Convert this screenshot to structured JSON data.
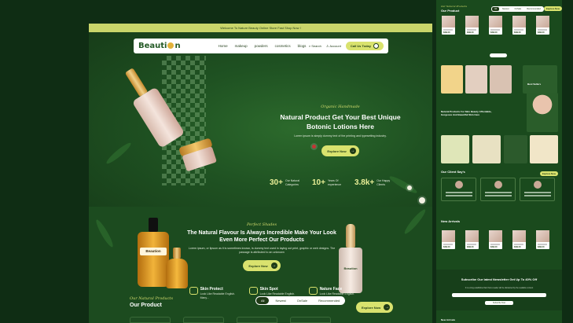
{
  "announcement": "Welcome To Nature Beauty Online Store Fast Shop Now !",
  "brand": {
    "logo": "Beaution"
  },
  "nav": {
    "links": [
      "Home",
      "makeup",
      "powders",
      "cosmetics",
      "blogs"
    ],
    "search": "Search",
    "account": "Account",
    "call_label": "Call Us Today"
  },
  "hero": {
    "script": "Organic Handmade",
    "title": "Natural Product Get Your Best Unique Botonic Lotions Here",
    "description": "Lorem ipsum is simply dummy text of the printing and typesetting industry.",
    "cta": "Explore Now",
    "stats": [
      {
        "value": "30+",
        "label": "Our Natural Categories"
      },
      {
        "value": "10+",
        "label": "Years Of experience"
      },
      {
        "value": "3.8k+",
        "label": "Our Happy Clients"
      }
    ]
  },
  "about": {
    "script": "Perfect Shades",
    "title": "The Natural Flavour Is Always Incredible Make Your Look Even More Perfect Our Products",
    "description": "Lorem ipsum, or lipsum as it is sometimes known, is dummy text used in laying out print, graphic or web designs. The passage is attributed to an unknown",
    "cta": "Explore Now",
    "bottle_label": "Beaution",
    "bottle_label_2": "Beaution",
    "features": [
      {
        "title": "Skin Protect",
        "desc": "Look Like Readable English. Many..."
      },
      {
        "title": "Skin Spot",
        "desc": "Look Like Readable English. Many..."
      },
      {
        "title": "Nature Face",
        "desc": "Look Like Readable English. Many..."
      }
    ]
  },
  "products": {
    "script": "Our Natural Products",
    "heading": "Our Product",
    "tabs": [
      "All",
      "Newest",
      "OnSale",
      "Recommended"
    ],
    "cta": "Explore Now"
  },
  "side": {
    "top_heading": "Our Product",
    "best_sellers": "Best Sellers",
    "promo_title": "Natural Products For Skin Beauty Affordable, Gorgeous And Beautiful Skin Care",
    "client_heading": "Our Client Say's",
    "new_arrivals": "New Arrivals",
    "newsletter_title": "Subscribe Our latest Newsletter Get Up To 40% Off",
    "newsletter_desc": "It is a long established fact that a reader will be distracted by the readable content",
    "newsletter_btn": "Subscribe Now",
    "footer_heading": "New Arrivals",
    "price": "$399.00"
  },
  "colors": {
    "accent": "#d9e26e",
    "dark_green": "#1b4a1f",
    "background": "#0f2d14"
  }
}
